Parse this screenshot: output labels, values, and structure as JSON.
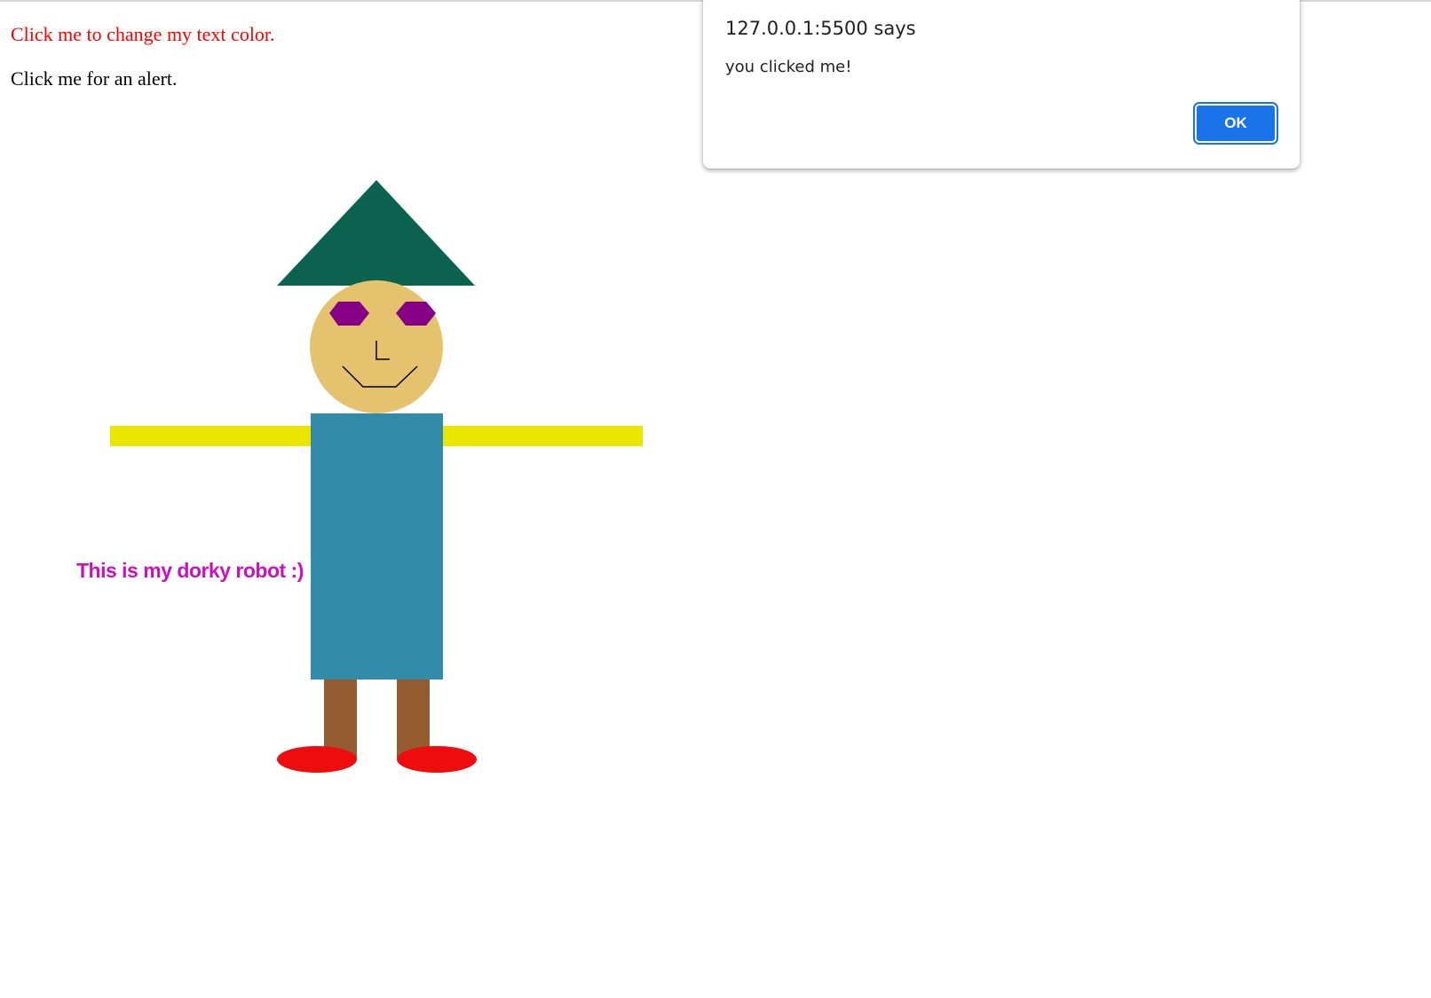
{
  "page": {
    "paragraph_color": {
      "text": "Click me to change my text color.",
      "color": "#ff0000"
    },
    "paragraph_alert": {
      "text": "Click me for an alert.",
      "color": "#000000"
    }
  },
  "dialog": {
    "title": "127.0.0.1:5500 says",
    "message": "you clicked me!",
    "ok_label": "OK",
    "accent": "#1a73e8"
  },
  "robot": {
    "caption": "This is my dorky robot :)",
    "colors": {
      "caption": "#cc11bb",
      "hat": "#0b634f",
      "head": "#e5c36e",
      "eyes": "#850085",
      "face_lines": "#000000",
      "arms": "#eae600",
      "body": "#328ca9",
      "legs": "#965c31",
      "feet": "#ee0c0c"
    }
  }
}
